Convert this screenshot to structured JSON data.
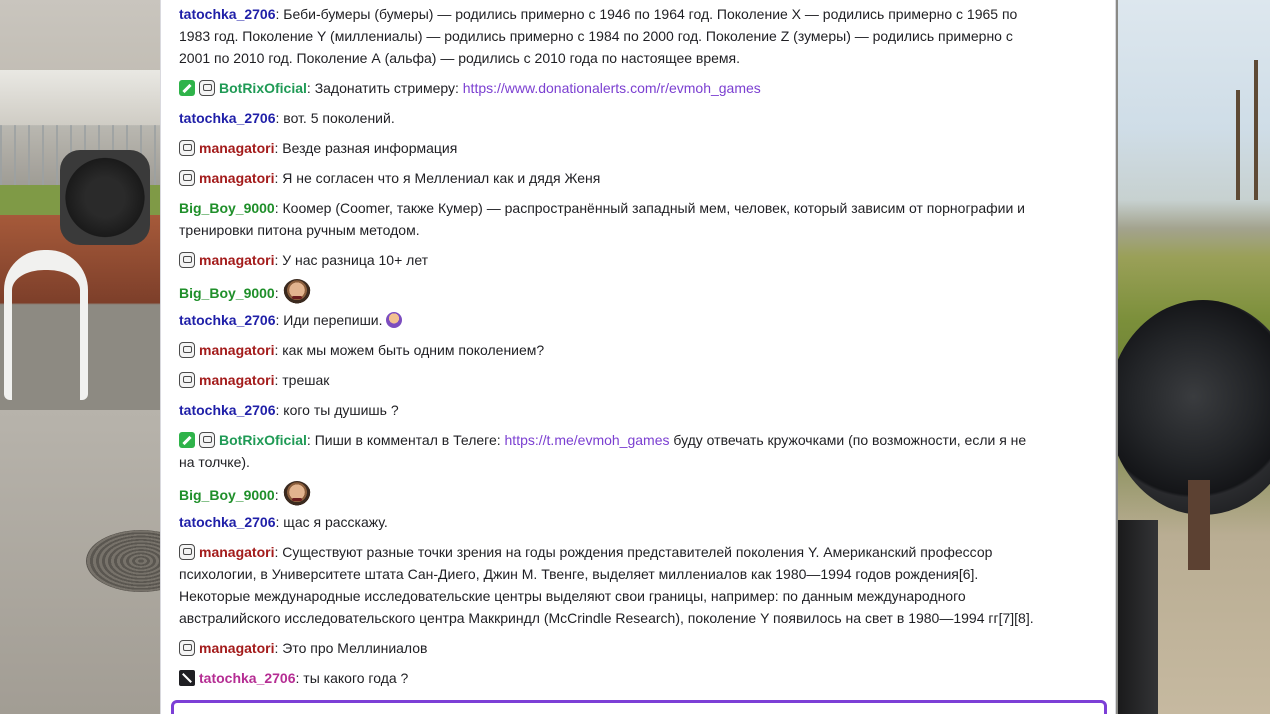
{
  "colors": {
    "user_blue": "#1f1fa8",
    "user_green": "#1f8f2a",
    "user_red": "#a31b1b",
    "user_botrix": "#1f9a55",
    "user_pink": "#b52d93",
    "link": "#7b3fd1",
    "input_border": "#7c3fd6"
  },
  "messages": [
    {
      "user": "tatochka_2706",
      "sep": ":",
      "lines": [
        "Беби-бумеры (бумеры) — родились примерно с 1946 по 1964 год. Поколение X — родились примерно с 1965 по",
        "1983 год. Поколение Y (миллениалы) — родились примерно с 1984 по 2000 год. Поколение Z (зумеры) — родились примерно с",
        "2001 по 2010 год. Поколение А (альфа) — родились с 2010 года по настоящее время."
      ]
    },
    {
      "user": "BotRixOficial",
      "sep": ":",
      "text": "Задонатить стримеру:",
      "link": "https://www.donationalerts.com/r/evmoh_games"
    },
    {
      "user": "tatochka_2706",
      "sep": ":",
      "text": "вот. 5 поколений."
    },
    {
      "user": "managatori",
      "sep": ":",
      "text": "Везде разная информация"
    },
    {
      "user": "managatori",
      "sep": ":",
      "text": "Я не согласен что я Меллениал как и дядя Женя"
    },
    {
      "user": "Big_Boy_9000",
      "sep": ":",
      "lines": [
        "Коомер (Coomer, также Кумер) — распространённый западный мем, человек, который зависим от порнографии и",
        "тренировки питона ручным методом."
      ]
    },
    {
      "user": "managatori",
      "sep": ":",
      "text": "У нас разница 10+ лет"
    },
    {
      "user": "Big_Boy_9000",
      "sep": ":",
      "text": ""
    },
    {
      "user": "tatochka_2706",
      "sep": ":",
      "text": "Иди перепиши."
    },
    {
      "user": "managatori",
      "sep": ":",
      "text": "как мы можем быть одним поколением?"
    },
    {
      "user": "managatori",
      "sep": ":",
      "text": "трешак"
    },
    {
      "user": "tatochka_2706",
      "sep": ":",
      "text": "кого ты душишь ?"
    },
    {
      "user": "BotRixOficial",
      "sep": ":",
      "text": "Пиши в комментал в Телеге:",
      "link": "https://t.me/evmoh_games",
      "tail": "буду отвечать кружочками (по возможности, если я не",
      "line2": "на толчке)."
    },
    {
      "user": "Big_Boy_9000",
      "sep": ":",
      "text": ""
    },
    {
      "user": "tatochka_2706",
      "sep": ":",
      "text": "щас я расскажу."
    },
    {
      "user": "managatori",
      "sep": ":",
      "lines": [
        "Существуют разные точки зрения на годы рождения представителей поколения Y. Американский профессор",
        "психологии, в Университете штата Сан-Диего, Джин М. Твенге, выделяет миллениалов как 1980—1994 годов рождения[6].",
        "Некоторые международные исследовательские центры выделяют свои границы, например: по данным международного",
        "австралийского исследовательского центра Маккриндл (McCrindle Research), поколение Y появилось на свет в 1980—1994 гг[7][8]."
      ]
    },
    {
      "user": "managatori",
      "sep": ":",
      "text": "Это про Меллиниалов"
    },
    {
      "user": "tatochka_2706",
      "sep": ":",
      "text": "ты какого года ?"
    }
  ]
}
